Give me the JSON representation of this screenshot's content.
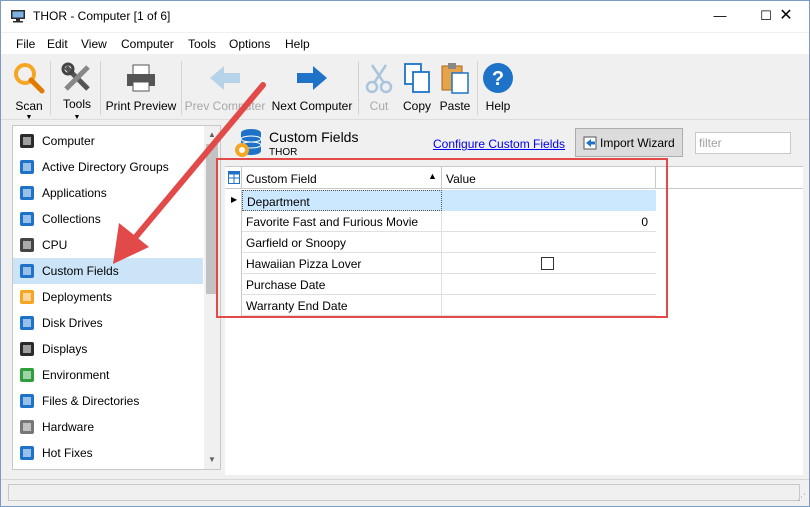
{
  "window": {
    "title": "THOR - Computer [1 of 6]",
    "min_glyph": "—",
    "max_glyph": "☐",
    "close_glyph": "✕"
  },
  "menu": [
    "File",
    "Edit",
    "View",
    "Computer",
    "Tools",
    "Options",
    "Help"
  ],
  "toolbar": {
    "scan": "Scan",
    "tools": "Tools",
    "print_preview": "Print Preview",
    "prev_computer": "Prev Computer",
    "next_computer": "Next Computer",
    "cut": "Cut",
    "copy": "Copy",
    "paste": "Paste",
    "help": "Help",
    "caret_glyph": "▼"
  },
  "nav": {
    "items": [
      {
        "label": "Computer",
        "icon": "computer-icon"
      },
      {
        "label": "Active Directory Groups",
        "icon": "ad-groups-icon"
      },
      {
        "label": "Applications",
        "icon": "applications-icon"
      },
      {
        "label": "Collections",
        "icon": "collections-icon"
      },
      {
        "label": "CPU",
        "icon": "cpu-icon"
      },
      {
        "label": "Custom Fields",
        "icon": "custom-fields-icon"
      },
      {
        "label": "Deployments",
        "icon": "deployments-icon"
      },
      {
        "label": "Disk Drives",
        "icon": "disk-drives-icon"
      },
      {
        "label": "Displays",
        "icon": "displays-icon"
      },
      {
        "label": "Environment",
        "icon": "environment-icon"
      },
      {
        "label": "Files & Directories",
        "icon": "files-icon"
      },
      {
        "label": "Hardware",
        "icon": "hardware-icon"
      },
      {
        "label": "Hot Fixes",
        "icon": "hotfixes-icon"
      }
    ],
    "selected_index": 5,
    "scroll_up_glyph": "▲",
    "scroll_down_glyph": "▼"
  },
  "panel": {
    "title": "Custom Fields",
    "subtitle": "THOR",
    "configure_link": "Configure Custom Fields",
    "import_button": "Import Wizard",
    "filter_placeholder": "filter"
  },
  "grid": {
    "columns": [
      "Custom Field",
      "Value"
    ],
    "sort_glyph": "▲",
    "row_arrow_glyph": "▶",
    "rows": [
      {
        "field": "Department",
        "value": "",
        "selected": true
      },
      {
        "field": "Favorite Fast and Furious Movie",
        "value": "0"
      },
      {
        "field": "Garfield or Snoopy",
        "value": ""
      },
      {
        "field": "Hawaiian Pizza Lover",
        "value": "",
        "checkbox": true
      },
      {
        "field": "Purchase Date",
        "value": ""
      },
      {
        "field": "Warranty End Date",
        "value": ""
      }
    ]
  },
  "colors": {
    "selection": "#cce4f7",
    "annotation_red": "#e24a4a",
    "link": "#0000ee"
  }
}
